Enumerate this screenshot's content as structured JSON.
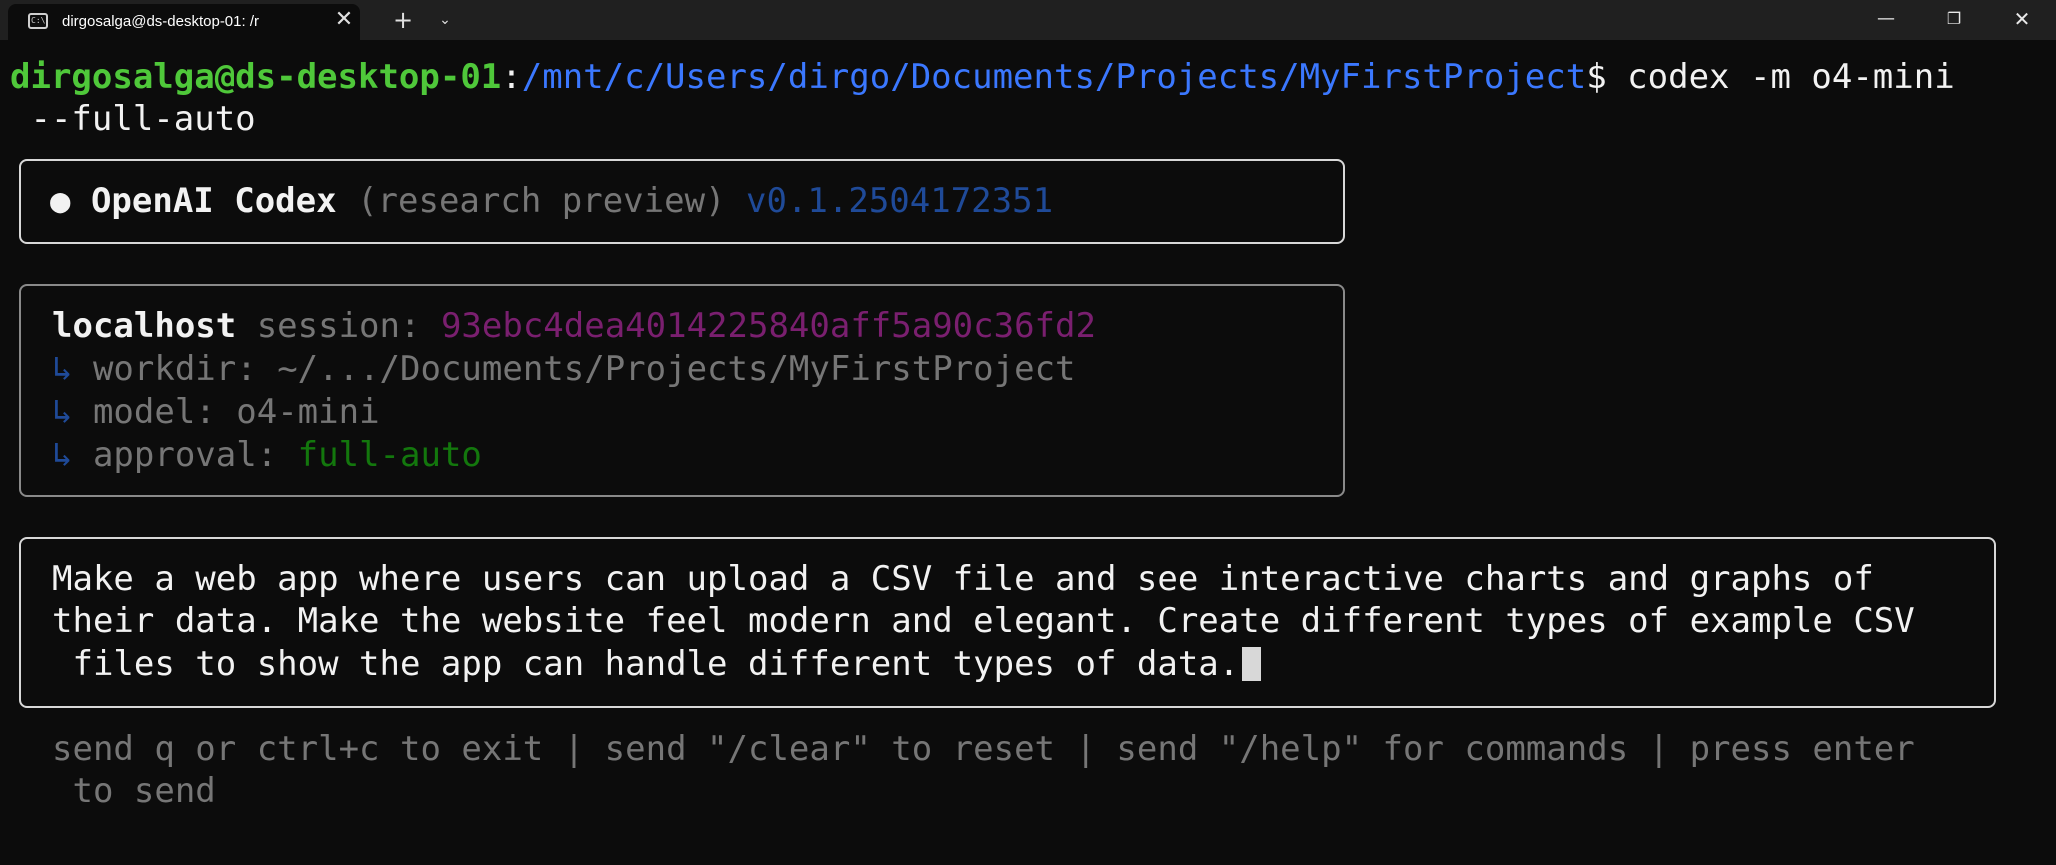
{
  "window": {
    "tab_title": "dirgosalga@ds-desktop-01: /r",
    "tab_icon": "terminal-icon",
    "tab_close_glyph": "✕",
    "new_tab_glyph": "+",
    "dropdown_glyph": "⌄",
    "minimize_glyph": "—",
    "restore_glyph": "❐",
    "close_glyph": "✕"
  },
  "prompt": {
    "user_host": "dirgosalga@ds-desktop-01",
    "separator": ":",
    "path": "/mnt/c/Users/dirgo/Documents/Projects/MyFirstProject",
    "dollar": "$",
    "command_line1": " codex -m o4-mini",
    "command_line2": " --full-auto"
  },
  "header_box": {
    "bullet": "●",
    "app_name": " OpenAI Codex ",
    "preview": "(research preview) ",
    "version": "v0.1.2504172351"
  },
  "session_box": {
    "host": "localhost",
    "session_label": " session: ",
    "session_id": "93ebc4dea4014225840aff5a90c36fd2",
    "arrow": "↳",
    "workdir_label": " workdir: ",
    "workdir_value": "~/.../Documents/Projects/MyFirstProject",
    "model_label": " model: ",
    "model_value": "o4-mini",
    "approval_label": " approval: ",
    "approval_value": "full-auto"
  },
  "input_box": {
    "line1": "Make a web app where users can upload a CSV file and see interactive charts and graphs of",
    "line2": "their data. Make the website feel modern and elegant. Create different types of example CSV",
    "line3": " files to show the app can handle different types of data."
  },
  "hint": {
    "line1": "send q or ctrl+c to exit | send \"/clear\" to reset | send \"/help\" for commands | press enter",
    "line2": " to send"
  },
  "colors": {
    "background": "#0c0c0c",
    "user_host": "#4fc83a",
    "path": "#3b78ff",
    "session_id": "#7a1f6f",
    "approval_value": "#13770d",
    "version": "#1f4a98"
  }
}
